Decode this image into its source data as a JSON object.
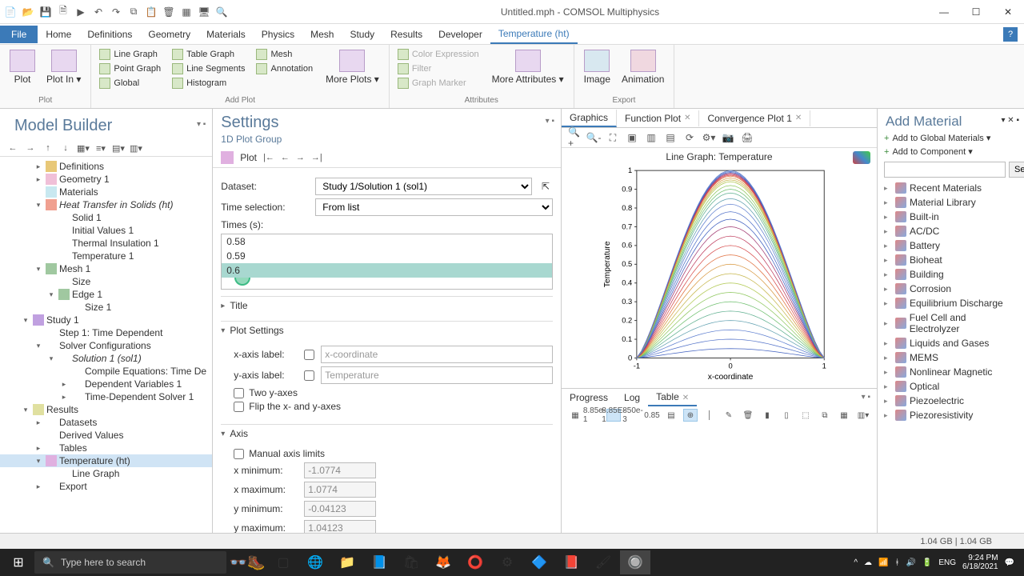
{
  "app": {
    "title": "Untitled.mph - COMSOL Multiphysics"
  },
  "menus": [
    "File",
    "Home",
    "Definitions",
    "Geometry",
    "Materials",
    "Physics",
    "Mesh",
    "Study",
    "Results",
    "Developer",
    "Temperature (ht)"
  ],
  "active_menu": "Temperature (ht)",
  "ribbon": {
    "plot_group": {
      "label": "Plot",
      "buttons": [
        "Plot",
        "Plot In ▾"
      ]
    },
    "add_plot": {
      "label": "Add Plot",
      "col1": [
        "Line Graph",
        "Point Graph",
        "Global"
      ],
      "col2": [
        "Table Graph",
        "Line Segments",
        "Histogram"
      ],
      "col3": [
        "Mesh",
        "Annotation"
      ],
      "more": "More Plots ▾"
    },
    "attributes": {
      "label": "Attributes",
      "items": [
        "Color Expression",
        "Filter",
        "Graph Marker"
      ],
      "more": "More Attributes ▾"
    },
    "export": {
      "label": "Export",
      "buttons": [
        "Image",
        "Animation"
      ]
    }
  },
  "model_builder": {
    "title": "Model Builder",
    "tree": [
      {
        "lvl": 2,
        "toggle": "▸",
        "icon": "ti-folder",
        "label": "Definitions"
      },
      {
        "lvl": 2,
        "toggle": "▸",
        "icon": "ti-geom",
        "label": "Geometry 1"
      },
      {
        "lvl": 2,
        "toggle": "",
        "icon": "ti-mat",
        "label": "Materials"
      },
      {
        "lvl": 2,
        "toggle": "▾",
        "icon": "ti-ht",
        "label": "Heat Transfer in Solids  (ht)",
        "italic": true
      },
      {
        "lvl": 3,
        "toggle": "",
        "icon": "",
        "label": "Solid 1"
      },
      {
        "lvl": 3,
        "toggle": "",
        "icon": "",
        "label": "Initial Values 1"
      },
      {
        "lvl": 3,
        "toggle": "",
        "icon": "",
        "label": "Thermal Insulation 1"
      },
      {
        "lvl": 3,
        "toggle": "",
        "icon": "",
        "label": "Temperature 1"
      },
      {
        "lvl": 2,
        "toggle": "▾",
        "icon": "ti-mesh",
        "label": "Mesh 1"
      },
      {
        "lvl": 3,
        "toggle": "",
        "icon": "",
        "label": "Size"
      },
      {
        "lvl": 3,
        "toggle": "▾",
        "icon": "ti-mesh",
        "label": "Edge 1"
      },
      {
        "lvl": 4,
        "toggle": "",
        "icon": "",
        "label": "Size 1"
      },
      {
        "lvl": 1,
        "toggle": "▾",
        "icon": "ti-study",
        "label": "Study 1"
      },
      {
        "lvl": 2,
        "toggle": "",
        "icon": "",
        "label": "Step 1: Time Dependent"
      },
      {
        "lvl": 2,
        "toggle": "▾",
        "icon": "",
        "label": "Solver Configurations"
      },
      {
        "lvl": 3,
        "toggle": "▾",
        "icon": "",
        "label": "Solution 1  (sol1)",
        "italic": true
      },
      {
        "lvl": 4,
        "toggle": "",
        "icon": "",
        "label": "Compile Equations: Time De"
      },
      {
        "lvl": 4,
        "toggle": "▸",
        "icon": "",
        "label": "Dependent Variables 1"
      },
      {
        "lvl": 4,
        "toggle": "▸",
        "icon": "",
        "label": "Time-Dependent Solver 1"
      },
      {
        "lvl": 1,
        "toggle": "▾",
        "icon": "ti-res",
        "label": "Results"
      },
      {
        "lvl": 2,
        "toggle": "▸",
        "icon": "",
        "label": "Datasets"
      },
      {
        "lvl": 2,
        "toggle": "",
        "icon": "",
        "label": "Derived Values"
      },
      {
        "lvl": 2,
        "toggle": "▸",
        "icon": "",
        "label": "Tables"
      },
      {
        "lvl": 2,
        "toggle": "▾",
        "icon": "ti-plot",
        "label": "Temperature (ht)",
        "selected": true
      },
      {
        "lvl": 3,
        "toggle": "",
        "icon": "",
        "label": "Line Graph"
      },
      {
        "lvl": 2,
        "toggle": "▸",
        "icon": "",
        "label": "Export"
      }
    ]
  },
  "settings": {
    "title": "Settings",
    "subtitle": "1D Plot Group",
    "plot_label": "Plot",
    "dataset_label": "Dataset:",
    "dataset_value": "Study 1/Solution 1 (sol1)",
    "time_sel_label": "Time selection:",
    "time_sel_value": "From list",
    "times_label": "Times (s):",
    "times": [
      "0.58",
      "0.59",
      "0.6"
    ],
    "selected_time_idx": 2,
    "sections": {
      "title": "Title",
      "plot_settings": "Plot Settings",
      "axis": "Axis"
    },
    "xaxis_label": "x-axis label:",
    "xaxis_value": "x-coordinate",
    "yaxis_label": "y-axis label:",
    "yaxis_value": "Temperature",
    "two_y": "Two y-axes",
    "flip": "Flip the x- and y-axes",
    "manual_limits": "Manual axis limits",
    "xmin_l": "x minimum:",
    "xmin_v": "-1.0774",
    "xmax_l": "x maximum:",
    "xmax_v": "1.0774",
    "ymin_l": "y minimum:",
    "ymin_v": "-0.04123",
    "ymax_l": "y maximum:",
    "ymax_v": "1.04123"
  },
  "graphics": {
    "tabs": [
      "Graphics",
      "Function Plot",
      "Convergence Plot 1"
    ],
    "active_tab": 0,
    "plot_title": "Line Graph: Temperature",
    "xlabel": "x-coordinate",
    "ylabel": "Temperature"
  },
  "chart_data": {
    "type": "line",
    "title": "Line Graph: Temperature",
    "xlabel": "x-coordinate",
    "ylabel": "Temperature",
    "xlim": [
      -1,
      1
    ],
    "ylim": [
      0,
      1
    ],
    "xticks": [
      -1,
      0,
      1
    ],
    "yticks": [
      0,
      0.1,
      0.2,
      0.3,
      0.4,
      0.5,
      0.6,
      0.7,
      0.8,
      0.9,
      1
    ],
    "description": "Family of ~60 arched temperature profiles over x in [-1,1], zero at boundaries, peaks at x=0 ranging from ~0.05 up to ~1.0 as time increases from 0.01 to 0.6 s.",
    "series_peaks_at_center": [
      0.05,
      0.1,
      0.15,
      0.2,
      0.25,
      0.3,
      0.35,
      0.4,
      0.45,
      0.5,
      0.55,
      0.6,
      0.65,
      0.7,
      0.74,
      0.78,
      0.82,
      0.85,
      0.88,
      0.9,
      0.92,
      0.94,
      0.95,
      0.96,
      0.97,
      0.975,
      0.98,
      0.985,
      0.99,
      0.995,
      1.0
    ],
    "x": [
      -1,
      -0.8,
      -0.6,
      -0.4,
      -0.2,
      0,
      0.2,
      0.4,
      0.6,
      0.8,
      1
    ],
    "colors": [
      "#4060c0",
      "#5070c8",
      "#6080d0",
      "#60a0b0",
      "#60b090",
      "#70c070",
      "#90c860",
      "#b0c850",
      "#c8b850",
      "#d89840",
      "#e07040",
      "#d85050",
      "#c04060",
      "#a03870"
    ]
  },
  "add_material": {
    "title": "Add Material",
    "add_globals": "Add to Global Materials ▾",
    "add_comp": "Add to Component ▾",
    "search": "Search",
    "items": [
      "Recent Materials",
      "Material Library",
      "Built-in",
      "AC/DC",
      "Battery",
      "Bioheat",
      "Building",
      "Corrosion",
      "Equilibrium Discharge",
      "Fuel Cell and Electrolyzer",
      "Liquids and Gases",
      "MEMS",
      "Nonlinear Magnetic",
      "Optical",
      "Piezoelectric",
      "Piezoresistivity"
    ]
  },
  "bottom": {
    "tabs": [
      "Progress",
      "Log",
      "Table"
    ],
    "active": 2,
    "tool_labels": [
      "8.85e-1",
      "8.85E-1",
      "850e-3",
      "0.85"
    ]
  },
  "status": {
    "mem": "1.04 GB | 1.04 GB"
  },
  "taskbar": {
    "search_placeholder": "Type here to search",
    "lang": "ENG",
    "time": "9:24 PM",
    "date": "6/18/2021"
  }
}
